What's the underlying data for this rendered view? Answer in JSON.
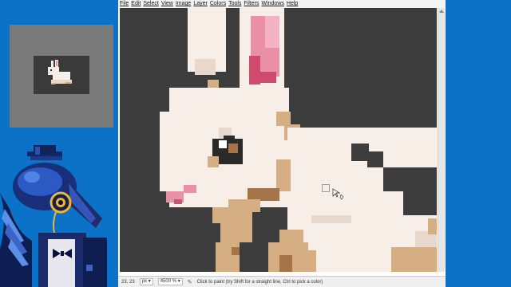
{
  "menu": [
    "File",
    "Edit",
    "Select",
    "View",
    "Image",
    "Layer",
    "Colors",
    "Tools",
    "Filters",
    "Windows",
    "Help"
  ],
  "status": {
    "coords": "23, 23",
    "unit": "px",
    "zoom": "4500 %",
    "hint": "Click to paint (try Shift for a straight line, Ctrl to pick a color)"
  },
  "icons": {
    "brush_cursor": "paintbrush-icon",
    "unit_dropdown": "chevron-down-icon",
    "zoom_dropdown": "chevron-down-icon"
  },
  "colors": {
    "canvas_bg": "#3c3c3c",
    "fur": "#f8eee8",
    "fur_shadow": "#e8d8cc",
    "ear_pink": "#e98fa6",
    "ear_pink_dark": "#cf4b6e",
    "tan": "#d6ae84",
    "brown": "#a57447",
    "dark": "#2a2a2a",
    "desktop": "#0b72c7"
  }
}
